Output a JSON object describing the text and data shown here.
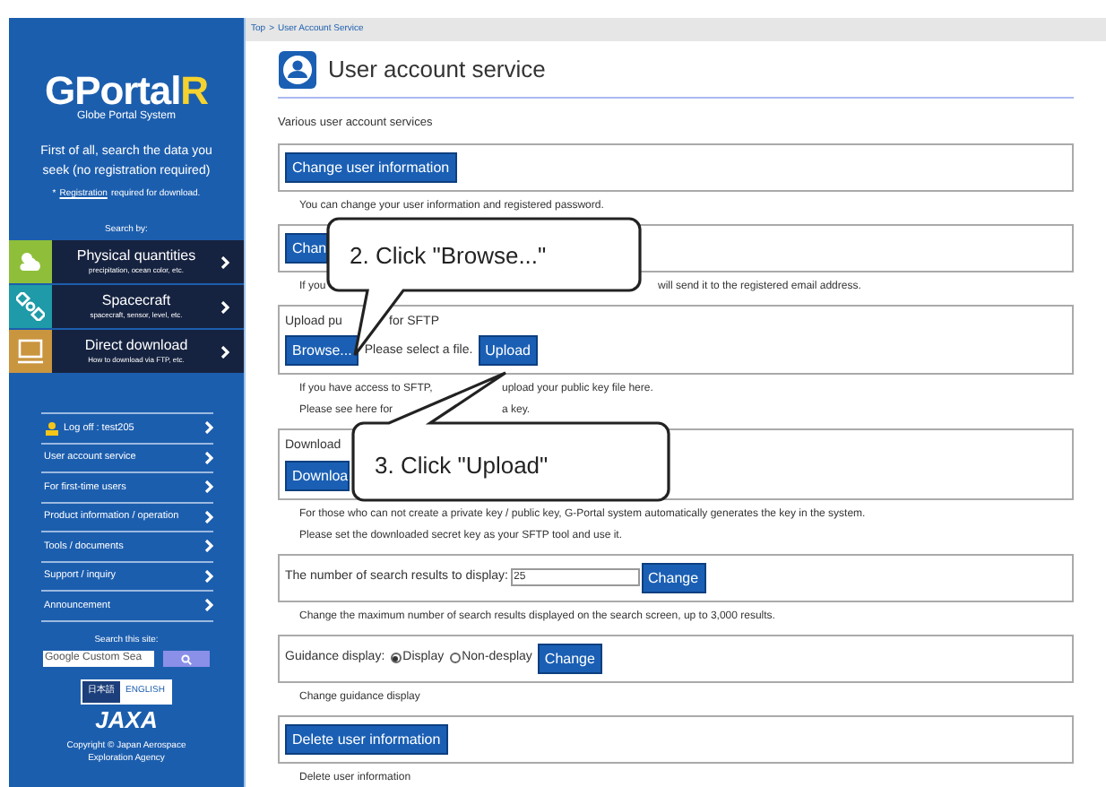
{
  "sidebar": {
    "logo": {
      "main": "GPortal",
      "accent": "R",
      "subtitle": "Globe Portal System"
    },
    "intro": "First of all, search the data you seek (no registration required)",
    "note": {
      "mark": "*",
      "link": "Registration",
      "text": "required for download."
    },
    "search_by": "Search by:",
    "categories": [
      {
        "title": "Physical quantities",
        "subtitle": "precipitation, ocean color, etc.",
        "color": "#8fbf3a"
      },
      {
        "title": "Spacecraft",
        "subtitle": "spacecraft, sensor, level, etc.",
        "color": "#1e9aa8"
      },
      {
        "title": "Direct download",
        "subtitle": "How to download via FTP, etc.",
        "color": "#c9953f"
      }
    ],
    "menu": [
      {
        "label": "Log off : test205",
        "kind": "user"
      },
      {
        "label": "User account service",
        "kind": "plain"
      },
      {
        "label": "For first-time users",
        "kind": "plain"
      },
      {
        "label": "Product information / operation",
        "kind": "plain"
      },
      {
        "label": "Tools / documents",
        "kind": "plain"
      },
      {
        "label": "Support / inquiry",
        "kind": "plain"
      },
      {
        "label": "Announcement",
        "kind": "plain"
      }
    ],
    "site_search": {
      "label": "Search this site:",
      "value": "Google Custom Sea"
    },
    "languages": [
      {
        "label": "日本語",
        "selected": true
      },
      {
        "label": "ENGLISH",
        "selected": false
      }
    ],
    "agency": "JAXA",
    "copyright": "Copyright © Japan Aerospace Exploration Agency"
  },
  "breadcrumb": [
    "Top",
    ">",
    "User Account Service"
  ],
  "page": {
    "title": "User account service",
    "intro": "Various user account services"
  },
  "sections": [
    {
      "kind": "button",
      "button": "Change user information",
      "desc": [
        [
          "You can change your user information and registered password."
        ]
      ]
    },
    {
      "kind": "button",
      "button": "Chan",
      "desc": [
        [
          "If you",
          "will send it to the registered email address."
        ]
      ]
    },
    {
      "kind": "upload",
      "label": [
        "Upload pu",
        "for SFTP"
      ],
      "browse": "Browse...",
      "file": "Please select a file.",
      "upload": "Upload",
      "desc": [
        [
          "If you have access to SFTP,",
          "upload your public key file here."
        ],
        [
          "Please see here for",
          "a key."
        ]
      ]
    },
    {
      "kind": "button",
      "label": "Download",
      "button": "Downloa",
      "desc": [
        [
          "For those who can not create a private key / public key, G-Portal system automatically generates the key in the system."
        ],
        [
          "Please set the downloaded secret key as your SFTP tool and use it."
        ]
      ]
    },
    {
      "kind": "number",
      "label": "The number of search results to display:",
      "value": "25",
      "button": "Change",
      "desc": [
        [
          "Change the maximum number of search results displayed on the search screen, up to 3,000 results."
        ]
      ]
    },
    {
      "kind": "radio",
      "label": "Guidance display:",
      "options": [
        {
          "label": "Display",
          "selected": true
        },
        {
          "label": "Non-desplay",
          "selected": false
        }
      ],
      "button": "Change",
      "desc": [
        [
          "Change guidance display"
        ]
      ]
    },
    {
      "kind": "button",
      "button": "Delete user information",
      "desc": [
        [
          "Delete user information"
        ]
      ]
    }
  ],
  "callouts": [
    "2. Click \"Browse...\"",
    "3. Click \"Upload\""
  ]
}
